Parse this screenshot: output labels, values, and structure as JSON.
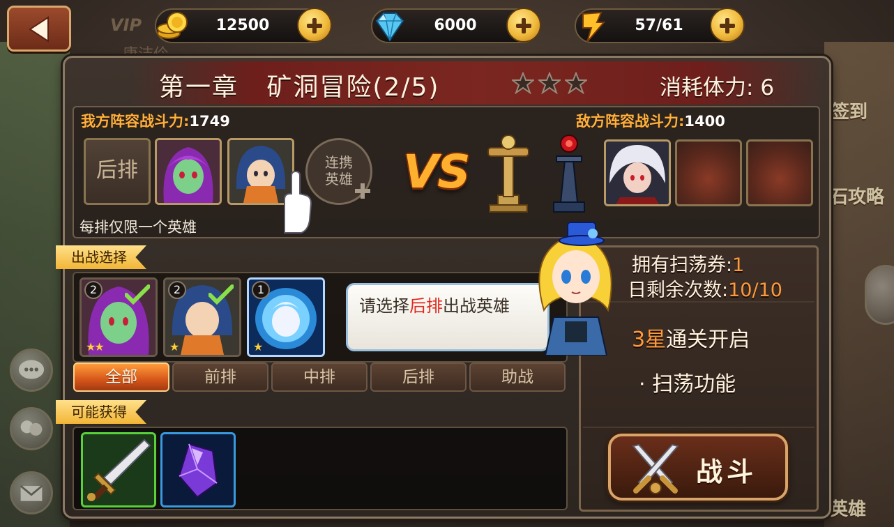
{
  "resources": {
    "gold": "12500",
    "gems": "6000",
    "stamina": "57/61"
  },
  "background": {
    "vip": "VIP",
    "left_faded": "康洁伶",
    "right_tags": [
      "签到",
      "石攻略",
      "英雄"
    ]
  },
  "stage": {
    "chapter": "第一章",
    "name": "矿洞冒险",
    "progress": "(2/5)",
    "stars_total": 3,
    "stars_earned": 0,
    "cost_label": "消耗体力:",
    "cost_value": "6"
  },
  "lineup": {
    "my_label": "我方阵容战斗力:",
    "my_power": "1749",
    "enemy_label": "敌方阵容战斗力:",
    "enemy_power": "1400",
    "back_row_slot": "后排",
    "link_hero": [
      "连携",
      "英雄"
    ],
    "note": "每排仅限一个英雄",
    "vs": "VS"
  },
  "hero_select": {
    "ribbon": "出战选择",
    "heroes": [
      {
        "level": "2",
        "selected": true,
        "stars": "★★"
      },
      {
        "level": "2",
        "selected": true,
        "stars": "★"
      },
      {
        "level": "1",
        "selected": false,
        "stars": "★"
      }
    ],
    "tabs": [
      "全部",
      "前排",
      "中排",
      "后排",
      "助战"
    ],
    "active_tab": "全部"
  },
  "hint": {
    "before": "请选择",
    "highlight": "后排",
    "after": "出战英雄"
  },
  "drops": {
    "ribbon": "可能获得",
    "items": [
      "sword-item",
      "purple-crystal-item"
    ]
  },
  "sweep": {
    "tickets_label": "拥有扫荡券:",
    "tickets_value": "1",
    "remaining_label": "日剩余次数:",
    "remaining_value": "10/10",
    "unlock_star": "3星",
    "unlock_text": "通关开启",
    "feature_text": "· 扫荡功能",
    "fight_label": "战斗"
  },
  "colors": {
    "accent": "#ffb13b",
    "title_band": "#7b2620",
    "active_tab": "#d5561a",
    "highlight_red": "#e0281e"
  }
}
